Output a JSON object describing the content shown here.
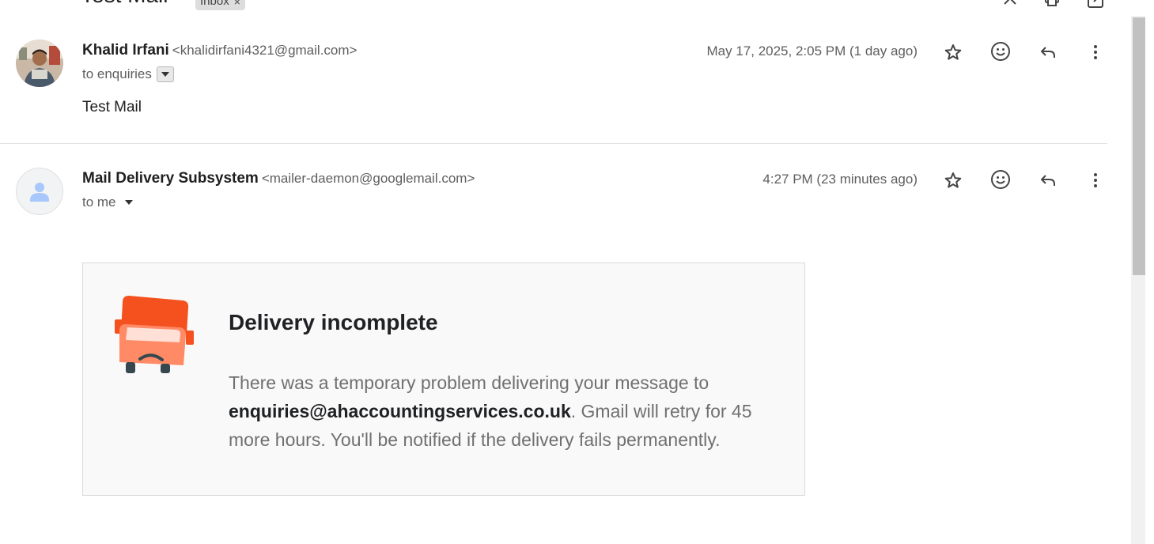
{
  "thread": {
    "subject": "Test Mail",
    "label": "Inbox",
    "label_remove": "×"
  },
  "messages": [
    {
      "sender_name": "Khalid Irfani",
      "sender_email": "<khalidirfani4321@gmail.com>",
      "recipient": "to enquiries",
      "date": "May 17, 2025, 2:05 PM (1 day ago)",
      "body": "Test Mail"
    },
    {
      "sender_name": "Mail Delivery Subsystem",
      "sender_email": "<mailer-daemon@googlemail.com>",
      "recipient": "to me",
      "date": "4:27 PM (23 minutes ago)"
    }
  ],
  "bounce": {
    "title": "Delivery incomplete",
    "text_before": "There was a temporary problem delivering your message to ",
    "address": "enquiries@ahaccountingservices.co.uk",
    "text_after": ". Gmail will retry for 45 more hours. You'll be notified if the delivery fails permanently."
  },
  "icons": {
    "star": "star-icon",
    "emoji": "emoji-reaction-icon",
    "reply": "reply-icon",
    "more": "more-vertical-icon",
    "collapse": "chevron-up-icon",
    "print": "print-icon",
    "popout": "open-in-new-window-icon",
    "truck": "delivery-truck-icon"
  },
  "colors": {
    "truck_primary": "#f4511e",
    "truck_light": "#ff8a65",
    "default_avatar_bg": "#f1f3f4",
    "default_avatar_fg": "#a8c7fa"
  }
}
